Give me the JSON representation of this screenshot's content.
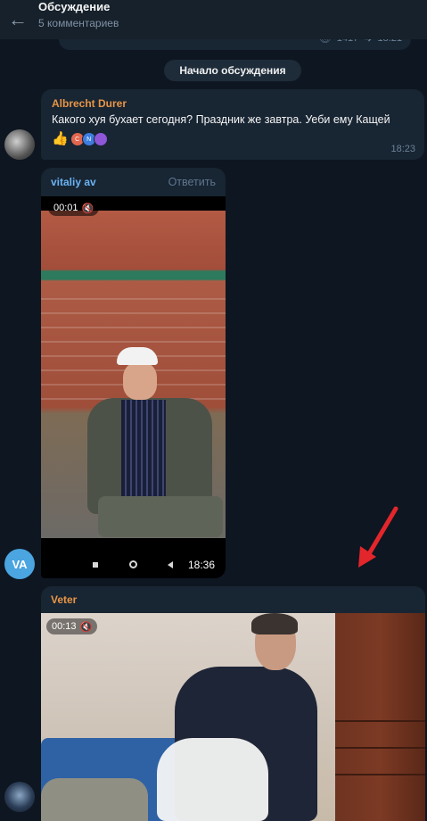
{
  "header": {
    "title": "Обсуждение",
    "subtitle": "5 комментариев",
    "back_icon": "arrow-left-icon"
  },
  "previous_post": {
    "views": "1417",
    "time": "18:21"
  },
  "service_message": "Начало обсуждения",
  "messages": [
    {
      "author": "Albrecht Durer",
      "text": "Какого хуя бухает сегодня? Праздник же завтра. Уеби ему Кащей",
      "reactions": {
        "emoji": "👍",
        "reactor_initials": [
          "C",
          "N",
          ""
        ]
      },
      "time": "18:23"
    },
    {
      "author": "vitaliy av",
      "reply_label": "Ответить",
      "avatar_initials": "VA",
      "video": {
        "duration": "00:01",
        "time": "18:36"
      }
    },
    {
      "author": "Veter",
      "video": {
        "duration": "00:13"
      }
    }
  ],
  "colors": {
    "background": "#0e1621",
    "bubble": "#182533",
    "author_orange": "#e89546",
    "author_blue": "#6ab3f3",
    "annotation_arrow": "#e3262b"
  }
}
